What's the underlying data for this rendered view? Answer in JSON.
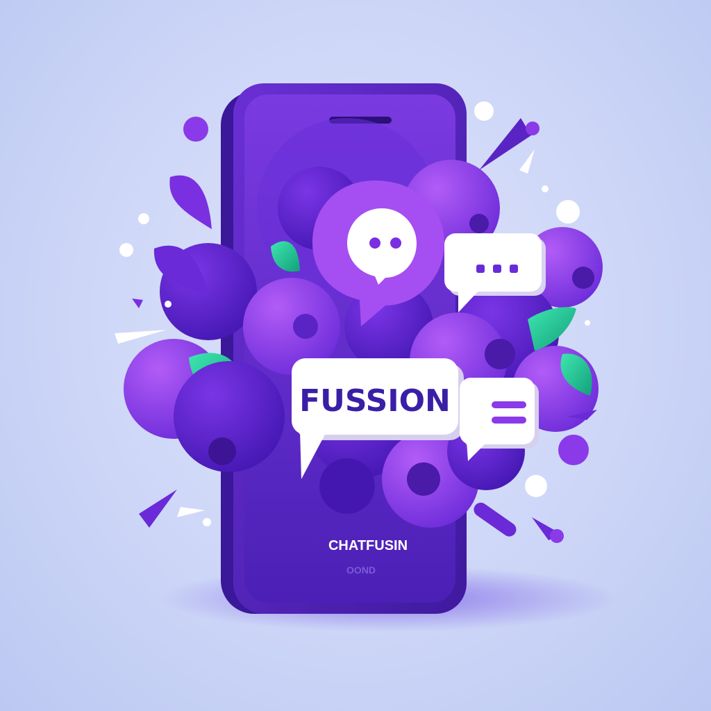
{
  "bubble_word": "FUSSION",
  "phone_brand": "CHATFUSIN",
  "phone_caption": "OOND",
  "colors": {
    "background": "#cdd6f7",
    "phone_body": "#4a1fb0",
    "phone_screen": "#5a25c4",
    "blob_dark": "#4b1fc0",
    "blob_mid": "#6d2ee0",
    "blob_light": "#9a4cf2",
    "leaf_green": "#1fcf96",
    "bubble_white": "#ffffff",
    "text_purple": "#3a1fa6"
  },
  "icons": [
    "chat-bubble-icon",
    "typing-dots-bubble-icon",
    "menu-lines-bubble-icon",
    "leaf-icon"
  ]
}
